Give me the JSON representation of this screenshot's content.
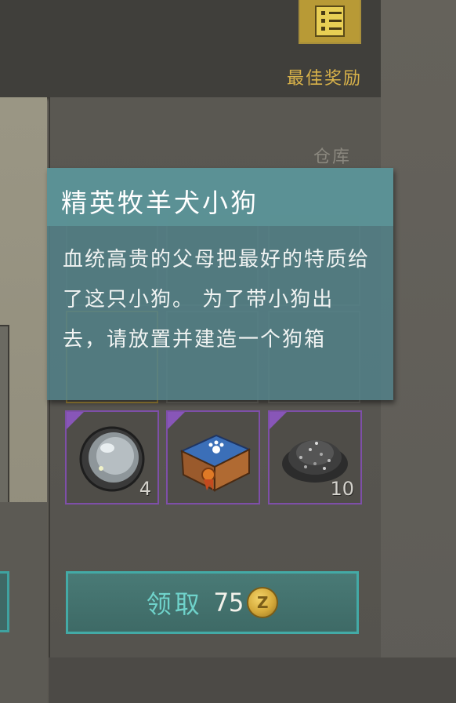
{
  "header": {
    "best_reward_label": "最佳奖励",
    "badge_icon": "reward-list-icon"
  },
  "storage": {
    "label": "仓库"
  },
  "tooltip": {
    "title": "精英牧羊犬小狗",
    "description": "血统高贵的父母把最好的特质给了这只小狗。 为了带小狗出去，请放置并建造一个狗箱"
  },
  "items": [
    {
      "icon": "lens-icon",
      "count": "4"
    },
    {
      "icon": "dog-crate-icon",
      "count": ""
    },
    {
      "icon": "gravel-icon",
      "count": "10"
    }
  ],
  "claim": {
    "label": "领取",
    "cost": "75",
    "currency_icon": "coin-icon"
  },
  "colors": {
    "accent_teal": "#43aaa6",
    "gold_text": "#d8b24a",
    "rarity_purple": "#8856b8"
  }
}
